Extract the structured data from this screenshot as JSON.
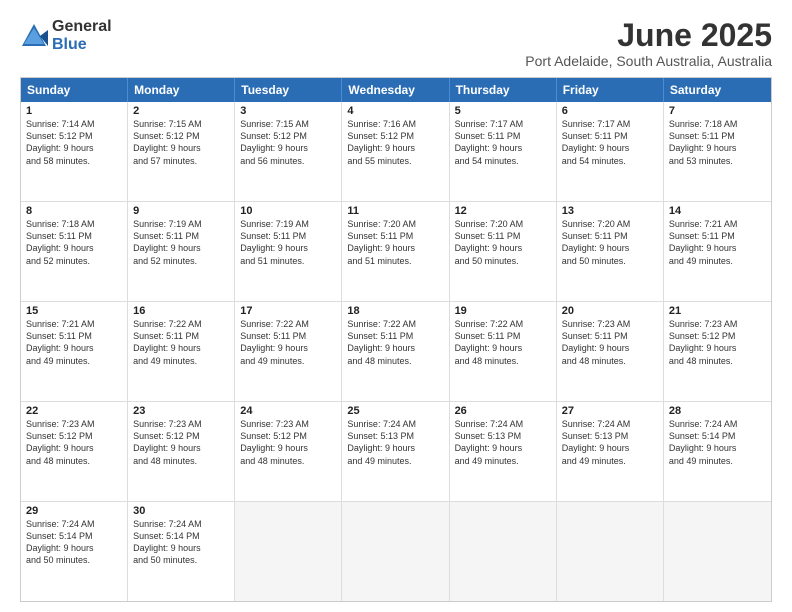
{
  "logo": {
    "general": "General",
    "blue": "Blue"
  },
  "header": {
    "month": "June 2025",
    "location": "Port Adelaide, South Australia, Australia"
  },
  "weekdays": [
    "Sunday",
    "Monday",
    "Tuesday",
    "Wednesday",
    "Thursday",
    "Friday",
    "Saturday"
  ],
  "rows": [
    [
      {
        "day": "1",
        "lines": [
          "Sunrise: 7:14 AM",
          "Sunset: 5:12 PM",
          "Daylight: 9 hours",
          "and 58 minutes."
        ]
      },
      {
        "day": "2",
        "lines": [
          "Sunrise: 7:15 AM",
          "Sunset: 5:12 PM",
          "Daylight: 9 hours",
          "and 57 minutes."
        ]
      },
      {
        "day": "3",
        "lines": [
          "Sunrise: 7:15 AM",
          "Sunset: 5:12 PM",
          "Daylight: 9 hours",
          "and 56 minutes."
        ]
      },
      {
        "day": "4",
        "lines": [
          "Sunrise: 7:16 AM",
          "Sunset: 5:12 PM",
          "Daylight: 9 hours",
          "and 55 minutes."
        ]
      },
      {
        "day": "5",
        "lines": [
          "Sunrise: 7:17 AM",
          "Sunset: 5:11 PM",
          "Daylight: 9 hours",
          "and 54 minutes."
        ]
      },
      {
        "day": "6",
        "lines": [
          "Sunrise: 7:17 AM",
          "Sunset: 5:11 PM",
          "Daylight: 9 hours",
          "and 54 minutes."
        ]
      },
      {
        "day": "7",
        "lines": [
          "Sunrise: 7:18 AM",
          "Sunset: 5:11 PM",
          "Daylight: 9 hours",
          "and 53 minutes."
        ]
      }
    ],
    [
      {
        "day": "8",
        "lines": [
          "Sunrise: 7:18 AM",
          "Sunset: 5:11 PM",
          "Daylight: 9 hours",
          "and 52 minutes."
        ]
      },
      {
        "day": "9",
        "lines": [
          "Sunrise: 7:19 AM",
          "Sunset: 5:11 PM",
          "Daylight: 9 hours",
          "and 52 minutes."
        ]
      },
      {
        "day": "10",
        "lines": [
          "Sunrise: 7:19 AM",
          "Sunset: 5:11 PM",
          "Daylight: 9 hours",
          "and 51 minutes."
        ]
      },
      {
        "day": "11",
        "lines": [
          "Sunrise: 7:20 AM",
          "Sunset: 5:11 PM",
          "Daylight: 9 hours",
          "and 51 minutes."
        ]
      },
      {
        "day": "12",
        "lines": [
          "Sunrise: 7:20 AM",
          "Sunset: 5:11 PM",
          "Daylight: 9 hours",
          "and 50 minutes."
        ]
      },
      {
        "day": "13",
        "lines": [
          "Sunrise: 7:20 AM",
          "Sunset: 5:11 PM",
          "Daylight: 9 hours",
          "and 50 minutes."
        ]
      },
      {
        "day": "14",
        "lines": [
          "Sunrise: 7:21 AM",
          "Sunset: 5:11 PM",
          "Daylight: 9 hours",
          "and 49 minutes."
        ]
      }
    ],
    [
      {
        "day": "15",
        "lines": [
          "Sunrise: 7:21 AM",
          "Sunset: 5:11 PM",
          "Daylight: 9 hours",
          "and 49 minutes."
        ]
      },
      {
        "day": "16",
        "lines": [
          "Sunrise: 7:22 AM",
          "Sunset: 5:11 PM",
          "Daylight: 9 hours",
          "and 49 minutes."
        ]
      },
      {
        "day": "17",
        "lines": [
          "Sunrise: 7:22 AM",
          "Sunset: 5:11 PM",
          "Daylight: 9 hours",
          "and 49 minutes."
        ]
      },
      {
        "day": "18",
        "lines": [
          "Sunrise: 7:22 AM",
          "Sunset: 5:11 PM",
          "Daylight: 9 hours",
          "and 48 minutes."
        ]
      },
      {
        "day": "19",
        "lines": [
          "Sunrise: 7:22 AM",
          "Sunset: 5:11 PM",
          "Daylight: 9 hours",
          "and 48 minutes."
        ]
      },
      {
        "day": "20",
        "lines": [
          "Sunrise: 7:23 AM",
          "Sunset: 5:11 PM",
          "Daylight: 9 hours",
          "and 48 minutes."
        ]
      },
      {
        "day": "21",
        "lines": [
          "Sunrise: 7:23 AM",
          "Sunset: 5:12 PM",
          "Daylight: 9 hours",
          "and 48 minutes."
        ]
      }
    ],
    [
      {
        "day": "22",
        "lines": [
          "Sunrise: 7:23 AM",
          "Sunset: 5:12 PM",
          "Daylight: 9 hours",
          "and 48 minutes."
        ]
      },
      {
        "day": "23",
        "lines": [
          "Sunrise: 7:23 AM",
          "Sunset: 5:12 PM",
          "Daylight: 9 hours",
          "and 48 minutes."
        ]
      },
      {
        "day": "24",
        "lines": [
          "Sunrise: 7:23 AM",
          "Sunset: 5:12 PM",
          "Daylight: 9 hours",
          "and 48 minutes."
        ]
      },
      {
        "day": "25",
        "lines": [
          "Sunrise: 7:24 AM",
          "Sunset: 5:13 PM",
          "Daylight: 9 hours",
          "and 49 minutes."
        ]
      },
      {
        "day": "26",
        "lines": [
          "Sunrise: 7:24 AM",
          "Sunset: 5:13 PM",
          "Daylight: 9 hours",
          "and 49 minutes."
        ]
      },
      {
        "day": "27",
        "lines": [
          "Sunrise: 7:24 AM",
          "Sunset: 5:13 PM",
          "Daylight: 9 hours",
          "and 49 minutes."
        ]
      },
      {
        "day": "28",
        "lines": [
          "Sunrise: 7:24 AM",
          "Sunset: 5:14 PM",
          "Daylight: 9 hours",
          "and 49 minutes."
        ]
      }
    ],
    [
      {
        "day": "29",
        "lines": [
          "Sunrise: 7:24 AM",
          "Sunset: 5:14 PM",
          "Daylight: 9 hours",
          "and 50 minutes."
        ]
      },
      {
        "day": "30",
        "lines": [
          "Sunrise: 7:24 AM",
          "Sunset: 5:14 PM",
          "Daylight: 9 hours",
          "and 50 minutes."
        ]
      },
      {
        "day": "",
        "lines": []
      },
      {
        "day": "",
        "lines": []
      },
      {
        "day": "",
        "lines": []
      },
      {
        "day": "",
        "lines": []
      },
      {
        "day": "",
        "lines": []
      }
    ]
  ]
}
